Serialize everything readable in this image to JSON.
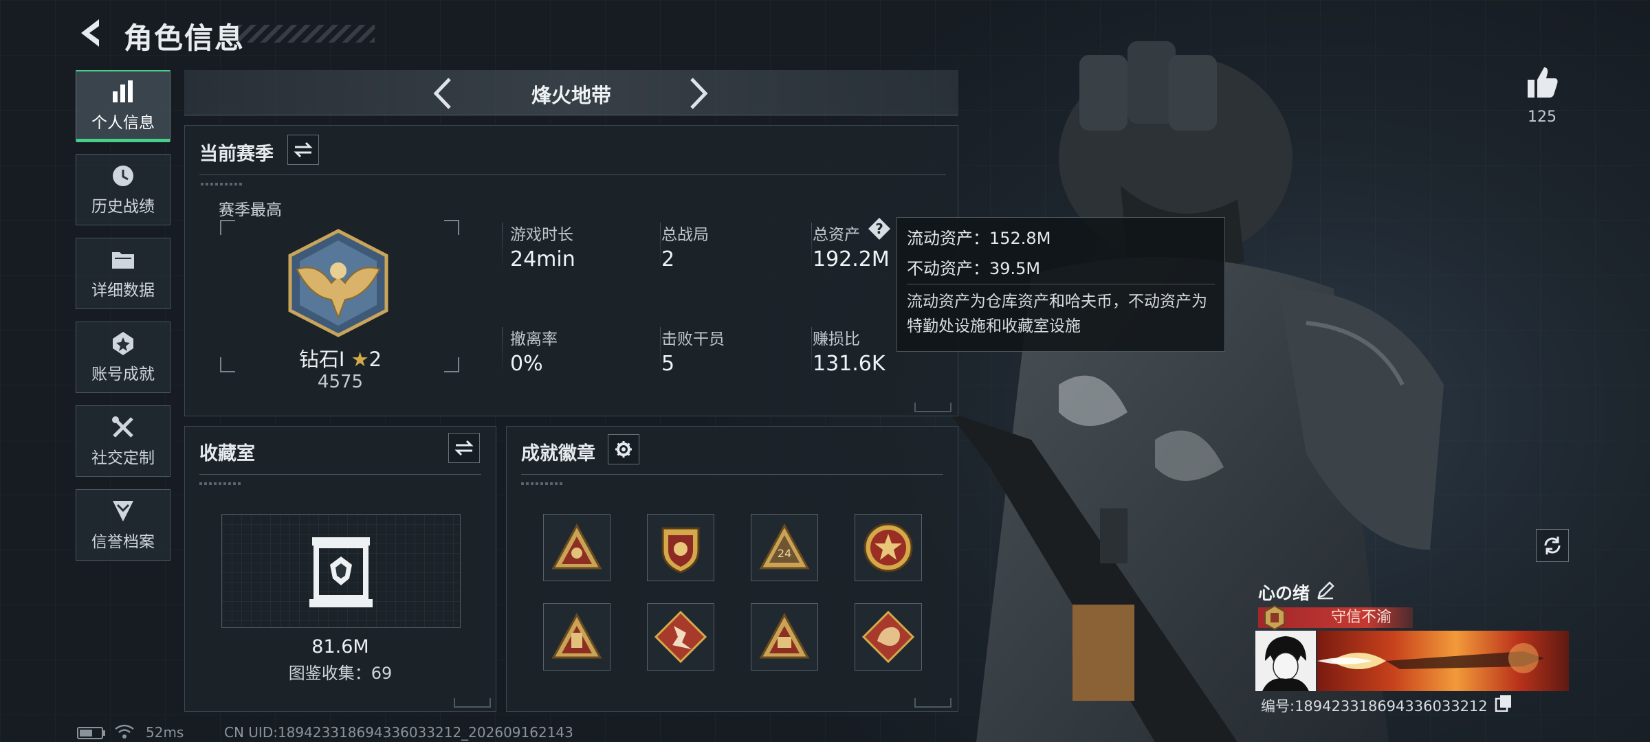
{
  "header": {
    "title": "角色信息",
    "back_icon": "back-arrow-icon"
  },
  "sidebar": {
    "items": [
      {
        "label": "个人信息",
        "icon": "bar-chart-icon",
        "active": true
      },
      {
        "label": "历史战绩",
        "icon": "history-clock-icon",
        "active": false
      },
      {
        "label": "详细数据",
        "icon": "folder-icon",
        "active": false
      },
      {
        "label": "账号成就",
        "icon": "achievement-icon",
        "active": false
      },
      {
        "label": "社交定制",
        "icon": "tools-icon",
        "active": false
      },
      {
        "label": "信誉档案",
        "icon": "shield-chevron-icon",
        "active": false
      }
    ]
  },
  "mode": {
    "title": "烽火地带"
  },
  "season": {
    "title": "当前赛季",
    "best_label": "赛季最高",
    "rank_name": "钻石Ⅰ",
    "rank_stars": "2",
    "rank_score": "4575",
    "stats": [
      {
        "label": "游戏时长",
        "value": "24min"
      },
      {
        "label": "总战局",
        "value": "2"
      },
      {
        "label": "总资产",
        "value": "192.2M"
      },
      {
        "label": "撤离率",
        "value": "0%"
      },
      {
        "label": "击败干员",
        "value": "5"
      },
      {
        "label": "赚损比",
        "value": "131.6K"
      }
    ]
  },
  "tooltip": {
    "liquid": "流动资产：152.8M",
    "fixed": "不动资产：39.5M",
    "description": "流动资产为仓库资产和哈夫币，不动资产为特勤处设施和收藏室设施"
  },
  "collection": {
    "title": "收藏室",
    "value": "81.6M",
    "count_text": "图鉴收集：69"
  },
  "badges": {
    "title": "成就徽章",
    "items": [
      "triangle-eye-badge",
      "shield-star-badge",
      "triangle-24-badge",
      "star-medal-badge",
      "triangle-lantern-badge",
      "diamond-runner-badge",
      "triangle-box-badge",
      "diamond-dragon-badge"
    ]
  },
  "profile": {
    "likes": "125",
    "name": "心の绪",
    "title_tag": "守信不渝",
    "id_text": "编号:18942331869433603321​2"
  },
  "status": {
    "ping": "52ms",
    "uid": "CN UID:18942331869433603321​2_202609162143"
  },
  "colors": {
    "accent_green": "#46d18a",
    "banner_red": "#c43a33",
    "gold": "#d4a94a"
  }
}
